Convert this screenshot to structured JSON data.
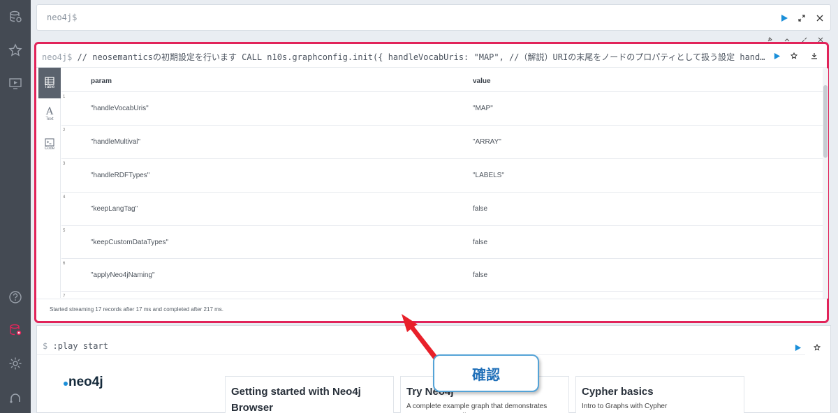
{
  "editor": {
    "prompt": "neo4j$"
  },
  "result_frame": {
    "query_prompt": "neo4j$",
    "query": " // neosemanticsの初期設定を行います CALL n10s.graphconfig.init({ handleVocabUris: \"MAP\", //（解説）URIの末尾をノードのプロパティとして扱う設定 hand…",
    "tabs": [
      {
        "label": "Table",
        "icon": "table-icon"
      },
      {
        "label": "Text",
        "icon": "text-icon"
      },
      {
        "label": "Code",
        "icon": "code-icon"
      }
    ],
    "columns": {
      "param": "param",
      "value": "value"
    },
    "rows": [
      {
        "num": "1",
        "param": "\"handleVocabUris\"",
        "value": "\"MAP\""
      },
      {
        "num": "2",
        "param": "\"handleMultival\"",
        "value": "\"ARRAY\""
      },
      {
        "num": "3",
        "param": "\"handleRDFTypes\"",
        "value": "\"LABELS\""
      },
      {
        "num": "4",
        "param": "\"keepLangTag\"",
        "value": "false"
      },
      {
        "num": "5",
        "param": "\"keepCustomDataTypes\"",
        "value": "false"
      },
      {
        "num": "6",
        "param": "\"applyNeo4jNaming\"",
        "value": "false"
      },
      {
        "num": "7",
        "param": "",
        "value": ""
      }
    ],
    "status": "Started streaming 17 records after 17 ms and completed after 217 ms."
  },
  "play_frame": {
    "prompt_symbol": "$",
    "command": ":play start",
    "logo": "neo4j",
    "cards": [
      {
        "title": "Getting started with Neo4j Browser",
        "desc": ""
      },
      {
        "title": "Try Neo4j",
        "desc": "A complete example graph that demonstrates common query patterns"
      },
      {
        "title": "Cypher basics",
        "desc": "Intro to Graphs with Cypher"
      }
    ]
  },
  "callout": {
    "label": "確認"
  },
  "colors": {
    "highlight": "#e1245a",
    "accent": "#1b8fd9",
    "sidebar": "#444a53"
  }
}
